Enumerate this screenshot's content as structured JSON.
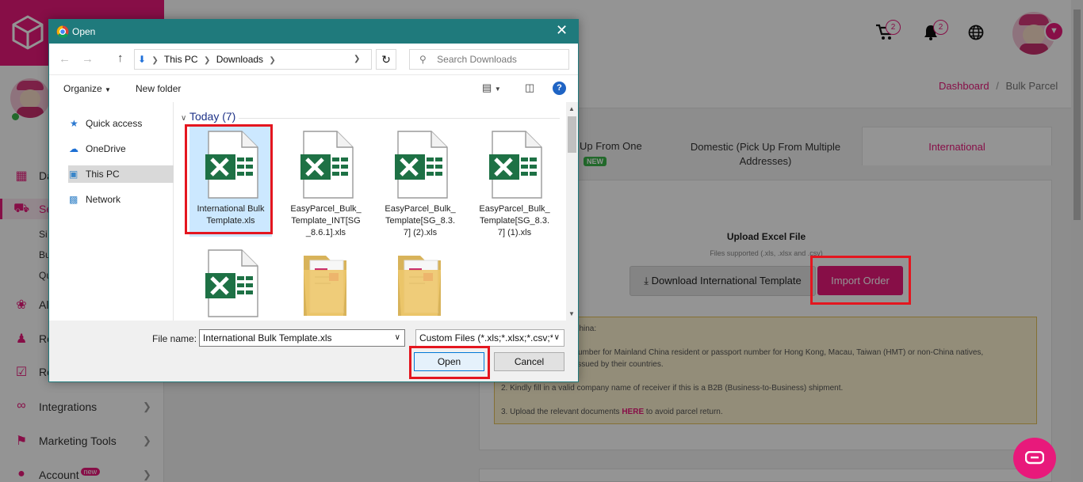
{
  "dialog": {
    "title": "Open",
    "breadcrumb": [
      "This PC",
      "Downloads"
    ],
    "search_placeholder": "Search Downloads",
    "organize_label": "Organize",
    "new_folder_label": "New folder",
    "nav_items": [
      "Quick access",
      "OneDrive",
      "This PC",
      "Network"
    ],
    "group_label": "Today (7)",
    "files": [
      {
        "name": "International Bulk Template.xls",
        "type": "excel",
        "selected": true
      },
      {
        "name": "EasyParcel_Bulk_Template_INT[SG_8.6.1].xls",
        "type": "excel"
      },
      {
        "name": "EasyParcel_Bulk_Template[SG_8.3.7] (2).xls",
        "type": "excel"
      },
      {
        "name": "EasyParcel_Bulk_Template[SG_8.3.7] (1).xls",
        "type": "excel"
      },
      {
        "name": "",
        "type": "excel"
      },
      {
        "name": "",
        "type": "folder"
      },
      {
        "name": "",
        "type": "folder"
      }
    ],
    "file_name_label": "File name:",
    "file_name_value": "International Bulk Template.xls",
    "file_type_value": "Custom Files (*.xls;*.xlsx;*.csv;*",
    "open_label": "Open",
    "cancel_label": "Cancel"
  },
  "header": {
    "cart_count": "2",
    "notification_count": "2"
  },
  "sidebar": {
    "items": [
      {
        "label": "Da",
        "icon": "dashboard-icon"
      },
      {
        "label": "Se",
        "icon": "truck-icon"
      },
      {
        "label": "Si",
        "icon": ""
      },
      {
        "label": "Bu",
        "icon": ""
      },
      {
        "label": "Qu",
        "icon": ""
      },
      {
        "label": "Al",
        "icon": "addresses-icon"
      },
      {
        "label": "Re",
        "icon": "referral-icon"
      },
      {
        "label": "Re",
        "icon": "gift-icon"
      },
      {
        "label": "Integrations",
        "icon": "link-icon"
      },
      {
        "label": "Marketing Tools",
        "icon": "megaphone-icon"
      },
      {
        "label": "Account",
        "icon": "user-icon"
      }
    ],
    "account_badge": "new"
  },
  "breadcrumb": {
    "home": "Dashboard",
    "separator": "/",
    "current": "Bulk Parcel"
  },
  "tabs": [
    {
      "label": "Up From One",
      "badge": "NEW"
    },
    {
      "label": "Domestic (Pick Up From Multiple Addresses)"
    },
    {
      "label": "International",
      "active": true
    }
  ],
  "upload": {
    "title": "Upload Excel File",
    "subtitle": "Files supported (.xls, .xlsx and .csv)",
    "download_label": "Download International Template",
    "import_label": "Import Order"
  },
  "notice": {
    "line0": "nt to China:",
    "line1a": "'s ID number for Mainland China resident or passport number for Hong Kong, Macau, Taiwan (HMT) or non-China natives,",
    "line1b": "ports issued by their countries.",
    "line2": "2. Kindly fill in a valid company name of receiver if this is a B2B (Business-to-Business) shipment.",
    "line3_prefix": "3. Upload the relevant documents ",
    "line3_link": "HERE",
    "line3_suffix": " to avoid parcel return."
  },
  "colors": {
    "brand": "#e8197b",
    "dialog_titlebar": "#1f7a7c",
    "highlight": "#e4161f",
    "excel_green": "#1e7145"
  }
}
